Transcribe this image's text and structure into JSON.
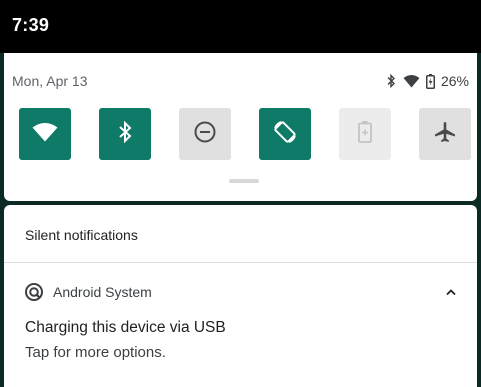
{
  "status_bar": {
    "time": "7:39"
  },
  "quick_settings": {
    "date": "Mon, Apr 13",
    "battery_percent": "26%",
    "status_icons": [
      "bluetooth-icon",
      "wifi-icon",
      "battery-icon"
    ],
    "tiles": [
      {
        "name": "wifi",
        "state": "on",
        "icon": "wifi-icon"
      },
      {
        "name": "bluetooth",
        "state": "on",
        "icon": "bluetooth-icon"
      },
      {
        "name": "do-not-disturb",
        "state": "off",
        "icon": "do-not-disturb-icon"
      },
      {
        "name": "auto-rotate",
        "state": "on",
        "icon": "auto-rotate-icon"
      },
      {
        "name": "battery-saver",
        "state": "disabled",
        "icon": "battery-saver-icon"
      },
      {
        "name": "airplane-mode",
        "state": "off",
        "icon": "airplane-icon"
      }
    ],
    "accent_color": "#0e7a67"
  },
  "notifications": {
    "section_title": "Silent notifications",
    "items": [
      {
        "app_name": "Android System",
        "app_icon": "android-system-icon",
        "title": "Charging this device via USB",
        "text": "Tap for more options."
      }
    ]
  }
}
